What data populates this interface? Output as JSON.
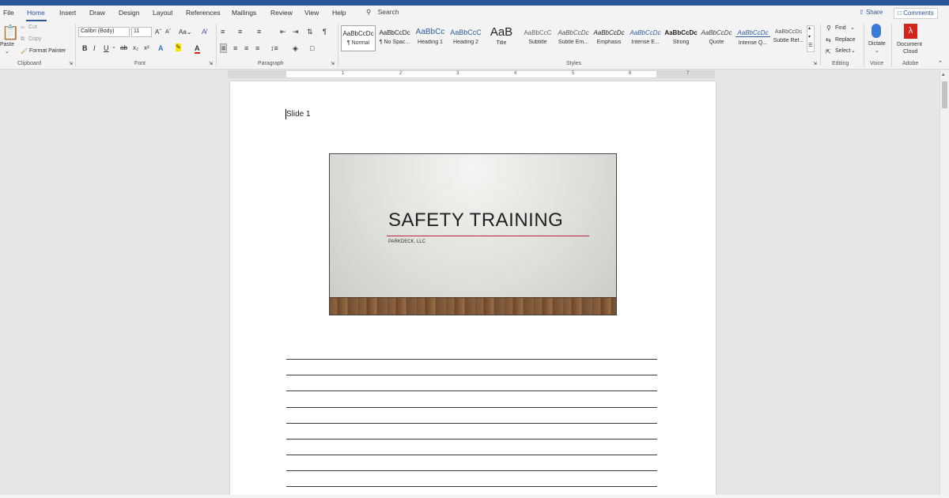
{
  "tabs": [
    "File",
    "Home",
    "Insert",
    "Draw",
    "Design",
    "Layout",
    "References",
    "Mailings",
    "Review",
    "View",
    "Help"
  ],
  "active_tab": "Home",
  "search_label": "Search",
  "share_label": "Share",
  "comments_label": "Comments",
  "clipboard": {
    "paste": "Paste",
    "cut": "Cut",
    "copy": "Copy",
    "format_painter": "Format Painter",
    "group": "Clipboard"
  },
  "font": {
    "name": "Calibri (Body)",
    "size": "11",
    "case_label": "Aa",
    "group": "Font"
  },
  "paragraph": {
    "group": "Paragraph"
  },
  "styles": {
    "group": "Styles",
    "items": [
      {
        "preview": "AaBbCcDc",
        "name": "¶ Normal"
      },
      {
        "preview": "AaBbCcDc",
        "name": "¶ No Spac..."
      },
      {
        "preview": "AaBbCc",
        "name": "Heading 1"
      },
      {
        "preview": "AaBbCcC",
        "name": "Heading 2"
      },
      {
        "preview": "AaB",
        "name": "Title"
      },
      {
        "preview": "AaBbCcC",
        "name": "Subtitle"
      },
      {
        "preview": "AaBbCcDc",
        "name": "Subtle Em..."
      },
      {
        "preview": "AaBbCcDc",
        "name": "Emphasis"
      },
      {
        "preview": "AaBbCcDc",
        "name": "Intense E..."
      },
      {
        "preview": "AaBbCcDc",
        "name": "Strong"
      },
      {
        "preview": "AaBbCcDc",
        "name": "Quote"
      },
      {
        "preview": "AaBbCcDc",
        "name": "Intense Q..."
      },
      {
        "preview": "AaBbCcDc",
        "name": "Subtle Ref..."
      }
    ]
  },
  "editing": {
    "find": "Find",
    "replace": "Replace",
    "select": "Select",
    "group": "Editing"
  },
  "voice": {
    "dictate": "Dictate",
    "group": "Voice"
  },
  "adobe": {
    "document_cloud_line1": "Document",
    "document_cloud_line2": "Cloud",
    "group": "Adobe"
  },
  "ruler_numbers": [
    "1",
    "2",
    "3",
    "4",
    "5",
    "6",
    "7"
  ],
  "document": {
    "slide_label": "Slide 1",
    "slide_title": "SAFETY TRAINING",
    "slide_subtitle": "PARKDECK, LLC",
    "note_line_count": 9
  },
  "colors": {
    "accent": "#2b579a",
    "slide_rule": "#b3263c",
    "adobe_red": "#d4251c"
  }
}
